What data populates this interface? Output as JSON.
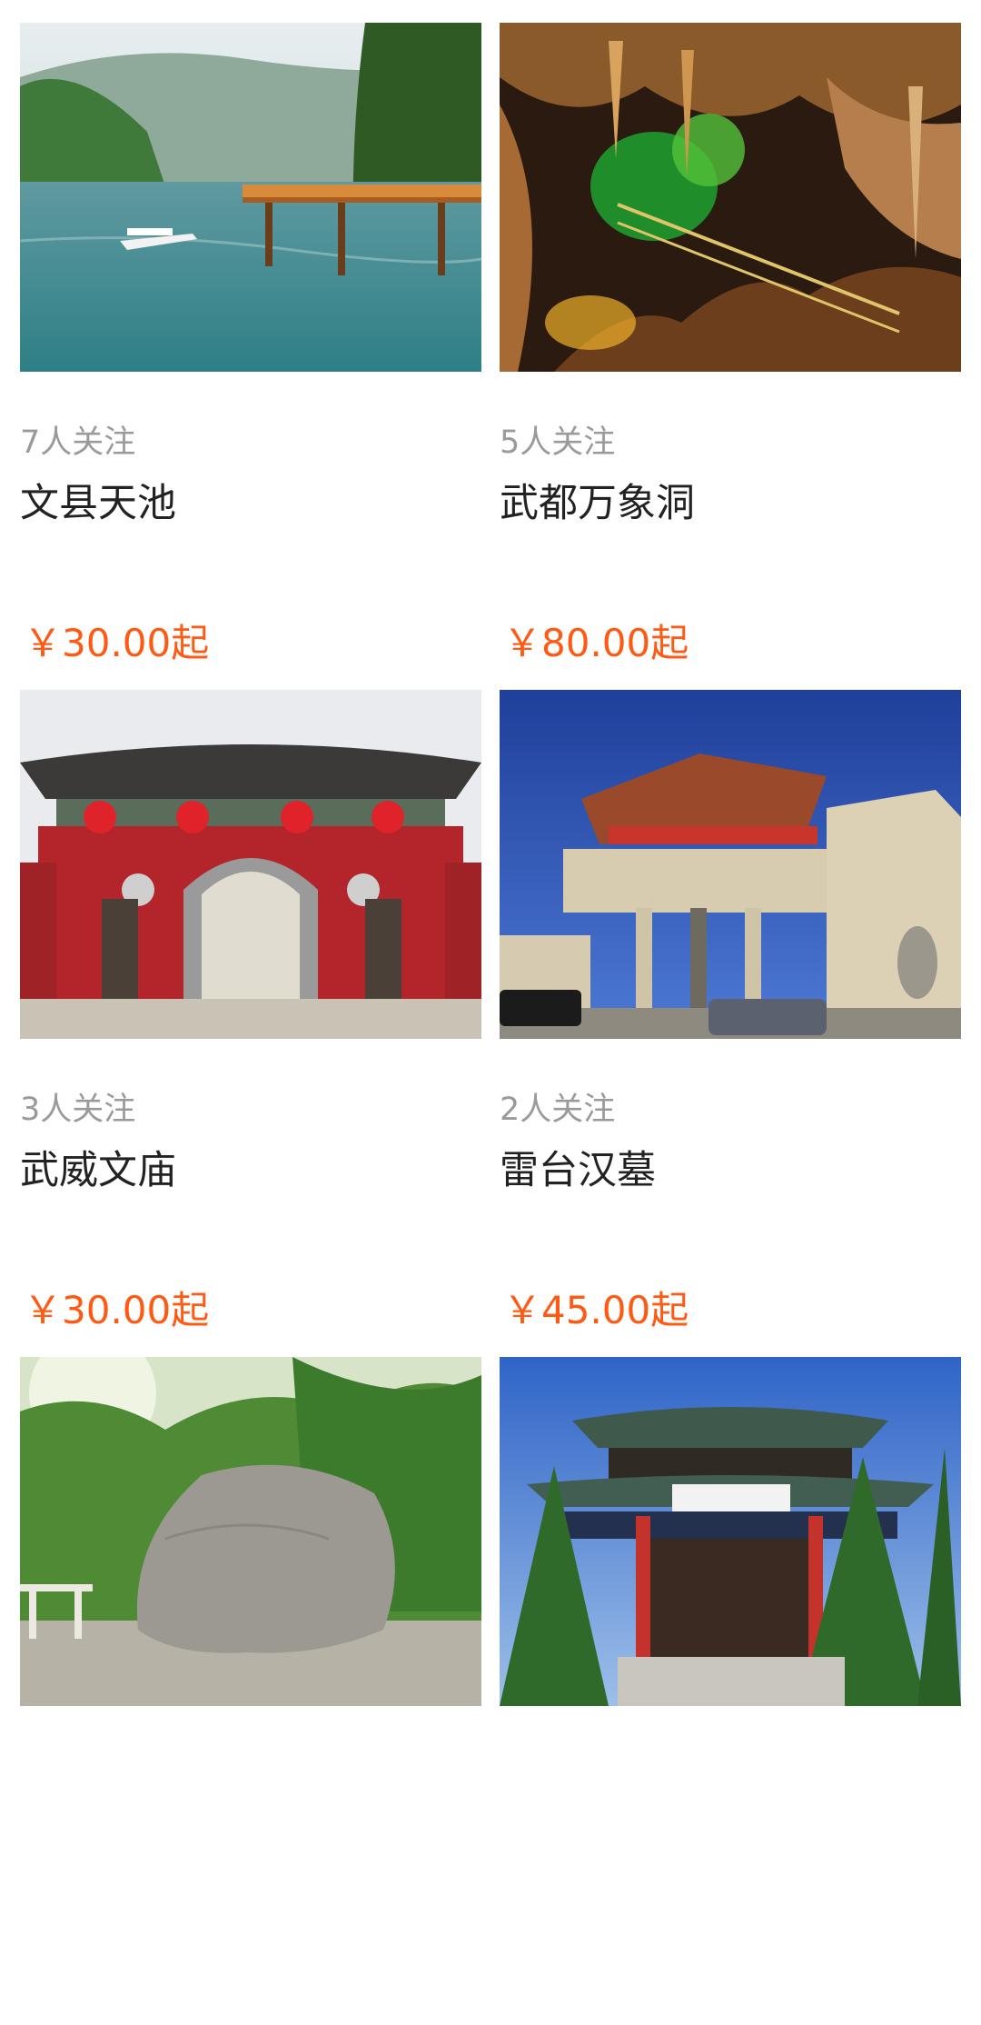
{
  "colors": {
    "price": "#ff5a14",
    "follow_text": "#9a9a9a",
    "title_text": "#222222"
  },
  "cards": [
    {
      "follow": "7人关注",
      "title": "文县天池",
      "price": "￥30.00起",
      "image": "lake-boardwalk-photo"
    },
    {
      "follow": "5人关注",
      "title": "武都万象洞",
      "price": "￥80.00起",
      "image": "cave-stalactite-photo"
    },
    {
      "follow": "3人关注",
      "title": "武威文庙",
      "price": "￥30.00起",
      "image": "temple-gate-photo"
    },
    {
      "follow": "2人关注",
      "title": "雷台汉墓",
      "price": "￥45.00起",
      "image": "memorial-gate-photo"
    },
    {
      "follow": "",
      "title": "",
      "price": "",
      "image": "inscribed-rock-photo"
    },
    {
      "follow": "",
      "title": "",
      "price": "",
      "image": "pavilion-gate-photo"
    }
  ]
}
